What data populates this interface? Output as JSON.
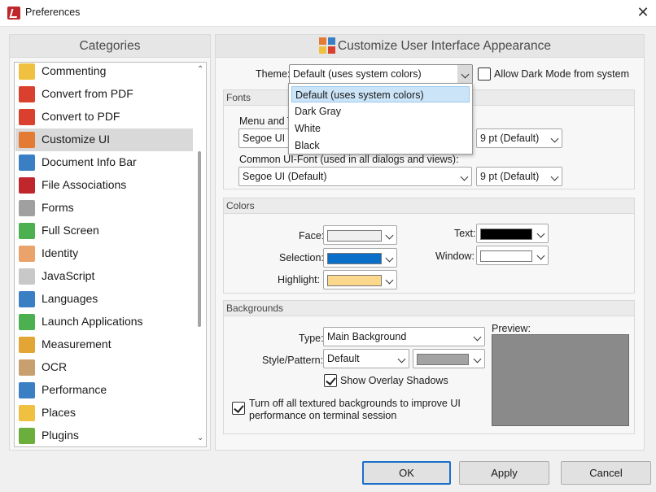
{
  "window": {
    "title": "Preferences",
    "close_glyph": "✕"
  },
  "categories": {
    "header": "Categories",
    "items": [
      {
        "label": "Commenting",
        "icon": "comment-icon",
        "color": "#f0c040"
      },
      {
        "label": "Convert from PDF",
        "icon": "convert-from-pdf-icon",
        "color": "#d9412e"
      },
      {
        "label": "Convert to PDF",
        "icon": "convert-to-pdf-icon",
        "color": "#d9412e"
      },
      {
        "label": "Customize UI",
        "icon": "customize-ui-icon",
        "color": "#e37b35"
      },
      {
        "label": "Document Info Bar",
        "icon": "info-icon",
        "color": "#3a7fc4"
      },
      {
        "label": "File Associations",
        "icon": "file-association-icon",
        "color": "#c0272d"
      },
      {
        "label": "Forms",
        "icon": "forms-icon",
        "color": "#a0a0a0"
      },
      {
        "label": "Full Screen",
        "icon": "full-screen-icon",
        "color": "#4caf50"
      },
      {
        "label": "Identity",
        "icon": "identity-icon",
        "color": "#e9a36b"
      },
      {
        "label": "JavaScript",
        "icon": "javascript-icon",
        "color": "#c8c8c8"
      },
      {
        "label": "Languages",
        "icon": "languages-icon",
        "color": "#3a7fc4"
      },
      {
        "label": "Launch Applications",
        "icon": "launch-apps-icon",
        "color": "#4caf50"
      },
      {
        "label": "Measurement",
        "icon": "measurement-icon",
        "color": "#e3a534"
      },
      {
        "label": "OCR",
        "icon": "ocr-icon",
        "color": "#c8a070"
      },
      {
        "label": "Performance",
        "icon": "performance-icon",
        "color": "#3a7fc4"
      },
      {
        "label": "Places",
        "icon": "places-icon",
        "color": "#f0c040"
      },
      {
        "label": "Plugins",
        "icon": "plugins-icon",
        "color": "#6cae3c"
      }
    ],
    "selected_index": 3
  },
  "main": {
    "header": "Customize User Interface Appearance",
    "theme_label": "Theme:",
    "theme_value": "Default (uses system colors)",
    "dark_mode_label": "Allow Dark Mode from system",
    "dark_mode_checked": false,
    "theme_options": [
      "Default (uses system colors)",
      "Dark Gray",
      "White",
      "Black"
    ],
    "theme_selected_index": 0,
    "fonts": {
      "title": "Fonts",
      "menu_font_label": "Menu and T",
      "menu_font_value": "Segoe UI (D",
      "menu_size_value": "9 pt (Default)",
      "common_font_label": "Common UI-Font (used in all dialogs and views):",
      "common_font_value": "Segoe UI (Default)",
      "common_size_value": "9 pt (Default)"
    },
    "colors": {
      "title": "Colors",
      "face_label": "Face:",
      "face_color": "#efefef",
      "selection_label": "Selection:",
      "selection_color": "#0a6fc8",
      "highlight_label": "Highlight:",
      "highlight_color": "#fbd88c",
      "text_label": "Text:",
      "text_color": "#000000",
      "window_label": "Window:",
      "window_color": "#ffffff"
    },
    "backgrounds": {
      "title": "Backgrounds",
      "type_label": "Type:",
      "type_value": "Main Background",
      "style_label": "Style/Pattern:",
      "style_value": "Default",
      "pattern_color": "#a3a3a3",
      "overlay_label": "Show Overlay Shadows",
      "overlay_checked": true,
      "turn_off_label_1": "Turn off all textured backgrounds to improve UI",
      "turn_off_label_2": "performance on terminal session",
      "turn_off_checked": true,
      "preview_label": "Preview:"
    }
  },
  "buttons": {
    "ok": "OK",
    "apply": "Apply",
    "cancel": "Cancel"
  }
}
